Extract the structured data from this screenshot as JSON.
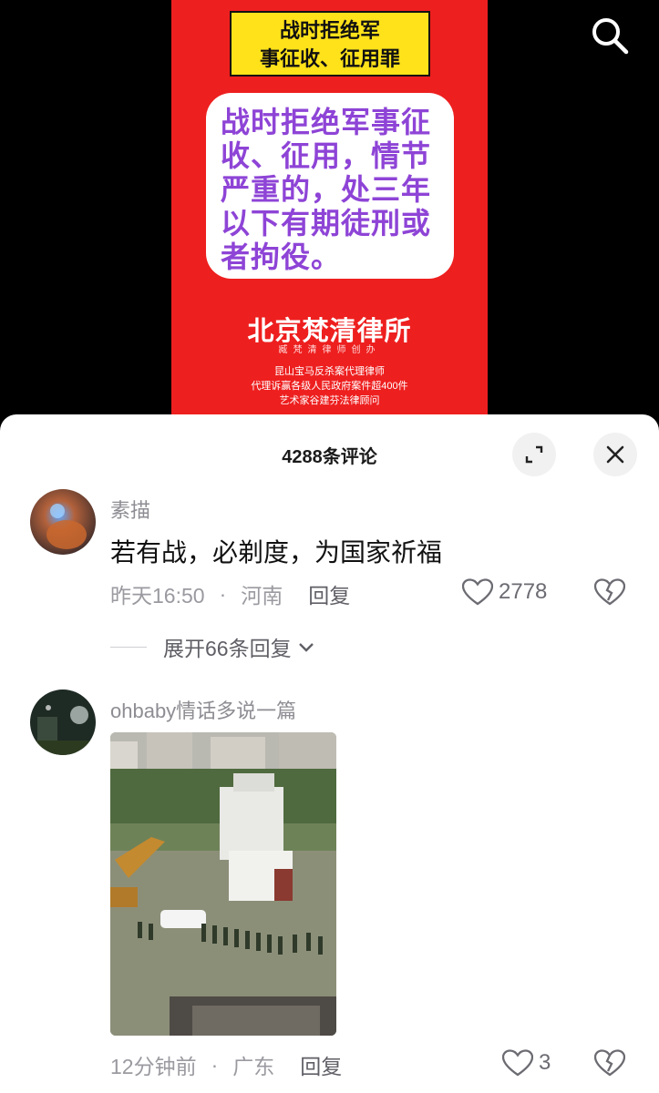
{
  "poster": {
    "banner_line1": "战时拒绝军",
    "banner_line2": "事征收、征用罪",
    "card_text": "战时拒绝军事征收、征用，情节严重的，处三年以下有期徒刑或者拘役。",
    "firm_name": "北京梵清律所",
    "firm_sub": "臧梵清律师创办",
    "lines": [
      "昆山宝马反杀案代理律师",
      "代理诉赢各级人民政府案件超400件",
      "艺术家谷建芬法律顾问"
    ]
  },
  "sheet": {
    "title": "4288条评论"
  },
  "comments": [
    {
      "username": "素描",
      "text": "若有战，必剃度，为国家祈福",
      "time": "昨天16:50",
      "location": "河南",
      "reply_label": "回复",
      "likes": "2778",
      "expand_label": "展开66条回复"
    },
    {
      "username": "ohbaby情话多说一篇",
      "time": "12分钟前",
      "location": "广东",
      "reply_label": "回复",
      "likes": "3"
    }
  ],
  "icons": {
    "search": "search-icon",
    "expand": "expand-icon",
    "close": "close-icon",
    "like": "heart-icon",
    "dislike": "broken-heart-icon",
    "chevron": "chevron-down-icon"
  },
  "colors": {
    "poster_red": "#ee1f1f",
    "banner_yellow": "#ffe21a",
    "card_purple": "#8e44d6",
    "meta_gray": "#9a9aa0"
  }
}
